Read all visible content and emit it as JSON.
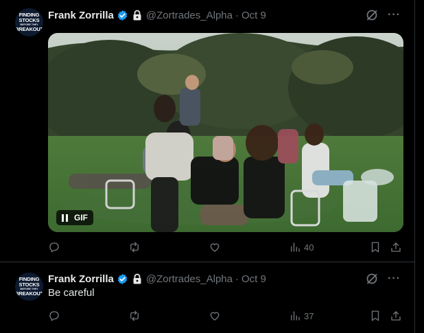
{
  "tweets": [
    {
      "avatar_text": [
        "FINDING",
        "STOCKS",
        "BEFORE THEY",
        "BREAKOUT"
      ],
      "name": "Frank Zorrilla",
      "handle": "@Zortrades_Alpha",
      "separator": "·",
      "date": "Oct 9",
      "text": "",
      "media": {
        "type": "gif",
        "badge": "GIF",
        "playback": "playing"
      },
      "actions": {
        "reply": "",
        "retweet": "",
        "like": "",
        "views": "40"
      }
    },
    {
      "avatar_text": [
        "FINDING",
        "STOCKS",
        "BEFORE THEY",
        "BREAKOUT"
      ],
      "name": "Frank Zorrilla",
      "handle": "@Zortrades_Alpha",
      "separator": "·",
      "date": "Oct 9",
      "text": "Be careful",
      "actions": {
        "reply": "",
        "retweet": "",
        "like": "",
        "views": "37"
      }
    }
  ],
  "icons": [
    "verified-badge-icon",
    "lock-icon",
    "grok-icon",
    "more-icon",
    "reply-icon",
    "retweet-icon",
    "like-icon",
    "views-icon",
    "bookmark-icon",
    "share-icon",
    "pause-icon"
  ],
  "colors": {
    "background": "#000000",
    "text": "#e7e9ea",
    "muted": "#71767b",
    "verified": "#1d9bf0",
    "divider": "#2f3336"
  }
}
